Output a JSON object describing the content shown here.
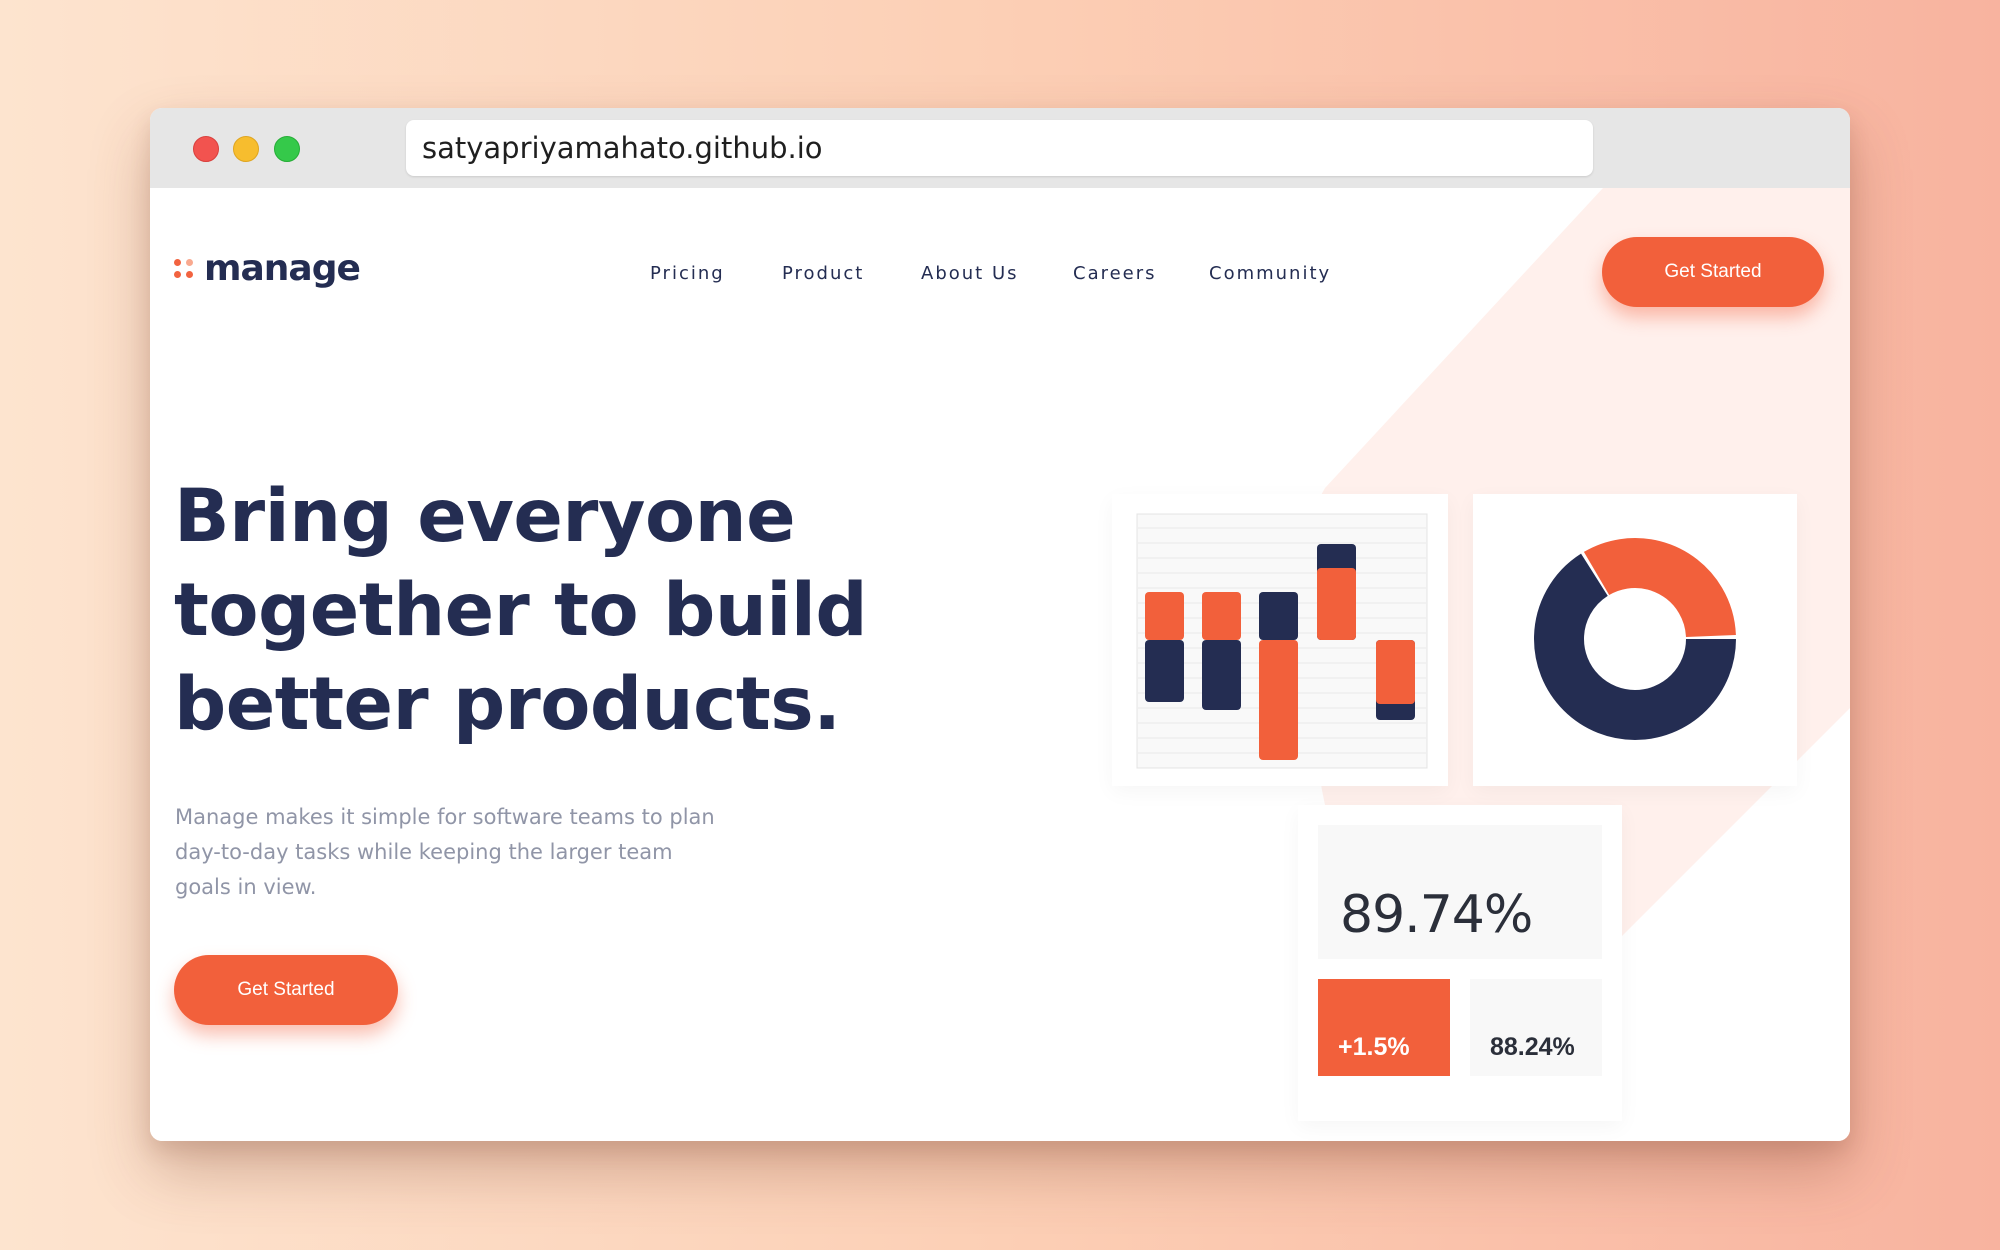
{
  "browser": {
    "url": "satyapriyamahato.github.io"
  },
  "header": {
    "logo_text": "manage",
    "nav": [
      "Pricing",
      "Product",
      "About Us",
      "Careers",
      "Community"
    ],
    "cta_label": "Get Started"
  },
  "hero": {
    "title_lines": [
      "Bring everyone",
      "together to build",
      "better products."
    ],
    "subtitle_lines": [
      "Manage makes it simple for software teams to plan",
      "day-to-day tasks while keeping the larger team",
      "goals in view."
    ],
    "cta_label": "Get Started"
  },
  "illustration": {
    "bar_chart": {
      "type": "bar",
      "bars": [
        {
          "orange_up": 48,
          "orange_down": 0,
          "navy_up": 0,
          "navy_down": 62
        },
        {
          "orange_up": 48,
          "orange_down": 0,
          "navy_up": 0,
          "navy_down": 70
        },
        {
          "orange_up": 0,
          "orange_down": 120,
          "navy_up": 48,
          "navy_down": 0
        },
        {
          "orange_up": 72,
          "orange_down": 0,
          "navy_up": 96,
          "navy_down": 0
        },
        {
          "orange_up": 0,
          "orange_down": 64,
          "navy_up": 0,
          "navy_down": 80
        }
      ]
    },
    "donut": {
      "navy_fraction": 0.66,
      "orange_fraction": 0.34
    },
    "stats": {
      "main": "89.74%",
      "change": "+1.5%",
      "secondary": "88.24%"
    }
  },
  "colors": {
    "accent": "#f2603b",
    "navy": "#242d52",
    "muted_text": "#9095a7",
    "shape": "#fff0ec"
  }
}
